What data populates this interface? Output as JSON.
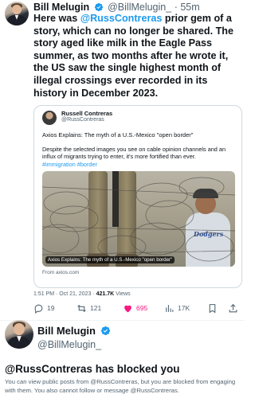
{
  "tweet": {
    "author_name": "Bill Melugin",
    "author_handle": "@BillMelugin_",
    "time": "· 55m",
    "text_part1": "Here was ",
    "mention": "@RussContreras",
    "text_part2": " prior gem of a story, which can no longer be shared. The story aged like milk in the Eagle Pass summer, as two months after he wrote it, the US saw the single highest month of illegal crossings ever recorded in its history in December 2023."
  },
  "quote": {
    "author_name": "Russell Contreras",
    "author_handle": "@RussContreras",
    "title": "Axios Explains: The myth of a U.S.-Mexico \"open border\"",
    "text": "Despite the selected images you see on cable opinion channels and an influx of migrants trying to enter, it's more fortified than ever.",
    "hashtags": "#immigration #border",
    "image_caption": "Axios Explains: The myth of a U.S.-Mexico \"open border\"",
    "image_logo": "Dodgers",
    "link_source": "From axios.com",
    "timestamp": "1:51 PM · Oct 21, 2023 · ",
    "views_count": "421.7K",
    "views_label": " Views"
  },
  "actions": {
    "replies": "19",
    "retweets": "121",
    "likes": "695",
    "views": "17K",
    "icons": [
      "reply-icon",
      "retweet-icon",
      "heart-icon",
      "views-icon",
      "bookmark-icon",
      "share-icon"
    ],
    "like_color": "#f91880"
  },
  "blocked": {
    "name": "Bill Melugin",
    "handle": "@BillMelugin_",
    "title": "@RussContreras has blocked you",
    "description": "You can view public posts from @RussContreras, but you are blocked from engaging with them. You also cannot follow or message @RussContreras."
  },
  "colors": {
    "accent": "#1d9bf0",
    "text": "#0f1419",
    "muted": "#536471"
  }
}
